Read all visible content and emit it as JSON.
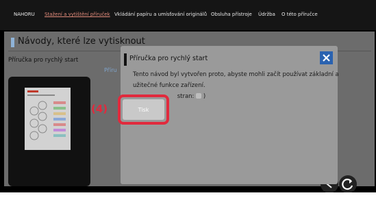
{
  "nav": {
    "items": [
      {
        "label": "NAHORU"
      },
      {
        "label": "Stažení a vytištění příruček",
        "active": true
      },
      {
        "label": "Vkládání papíru a umísťování originálů"
      },
      {
        "label": "Obsluha přístroje"
      },
      {
        "label": "Údržba"
      },
      {
        "label": "O této příručce"
      }
    ]
  },
  "content": {
    "title": "Návody, které lze vytisknout",
    "subtitle": "Příručka pro rychlý start",
    "cut_link": "Příru"
  },
  "dialog": {
    "title": "Příručka pro rychlý start",
    "description_line1": "Tento návod byl vytvořen proto, abyste mohli začít používat základní a",
    "description_line2": "užitečné funkce zařízení.",
    "pages_label": "stran:",
    "pages_close": ")",
    "print_label": "Tisk",
    "close_glyph": "✕"
  },
  "callout": {
    "label": "(4)"
  },
  "colors": {
    "accent": "#e12a3d",
    "close": "#2a62b0",
    "active_nav": "#e08a7a"
  },
  "icons": [
    "close-icon",
    "reload-icon",
    "back-icon"
  ]
}
